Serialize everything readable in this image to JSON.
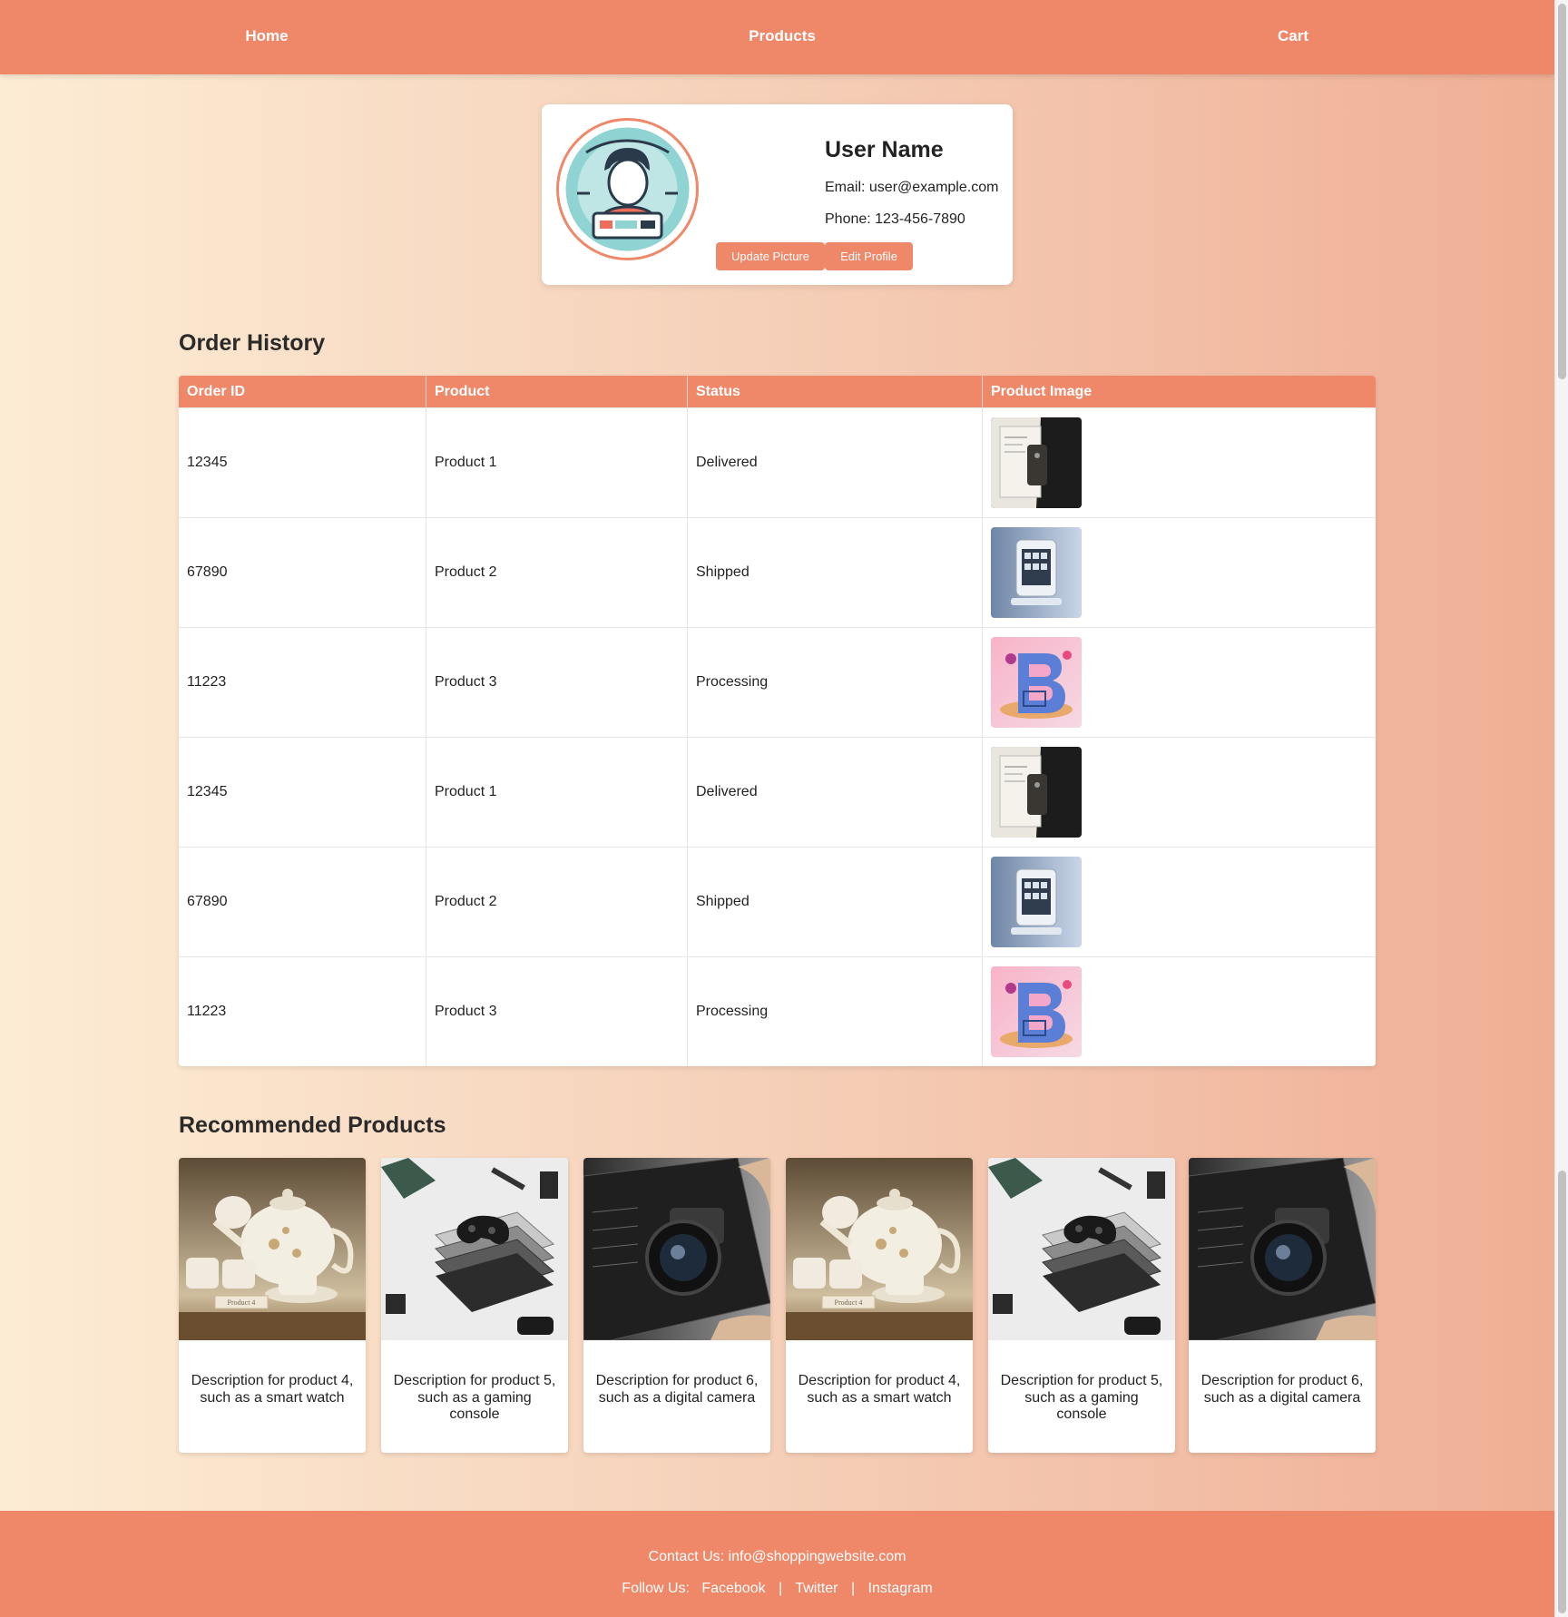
{
  "nav": {
    "home": "Home",
    "products": "Products",
    "cart": "Cart"
  },
  "profile": {
    "name": "User Name",
    "email": "Email: user@example.com",
    "phone": "Phone: 123-456-7890",
    "update_picture": "Update Picture",
    "edit_profile": "Edit Profile"
  },
  "orders": {
    "title": "Order History",
    "headers": [
      "Order ID",
      "Product",
      "Status",
      "Product Image"
    ],
    "rows": [
      {
        "id": "12345",
        "product": "Product 1",
        "status": "Delivered",
        "image": "smart-device-image"
      },
      {
        "id": "67890",
        "product": "Product 2",
        "status": "Shipped",
        "image": "white-gadget-image"
      },
      {
        "id": "11223",
        "product": "Product 3",
        "status": "Processing",
        "image": "colorful-b-logo-image"
      },
      {
        "id": "12345",
        "product": "Product 1",
        "status": "Delivered",
        "image": "smart-device-image"
      },
      {
        "id": "67890",
        "product": "Product 2",
        "status": "Shipped",
        "image": "white-gadget-image"
      },
      {
        "id": "11223",
        "product": "Product 3",
        "status": "Processing",
        "image": "colorful-b-logo-image"
      }
    ]
  },
  "recommended": {
    "title": "Recommended Products",
    "items": [
      {
        "desc": "Description for product 4, such as a smart watch",
        "image": "teapot-image",
        "image_label": "Product 4"
      },
      {
        "desc": "Description for product 5, such as a gaming console",
        "image": "game-console-image"
      },
      {
        "desc": "Description for product 6, such as a digital camera",
        "image": "digital-camera-image"
      },
      {
        "desc": "Description for product 4, such as a smart watch",
        "image": "teapot-image",
        "image_label": "Product 4"
      },
      {
        "desc": "Description for product 5, such as a gaming console",
        "image": "game-console-image"
      },
      {
        "desc": "Description for product 6, such as a digital camera",
        "image": "digital-camera-image"
      }
    ]
  },
  "footer": {
    "contact": "Contact Us: info@shoppingwebsite.com",
    "follow_label": "Follow Us:",
    "facebook": "Facebook",
    "twitter": "Twitter",
    "instagram": "Instagram",
    "separator": "|"
  },
  "colors": {
    "accent": "#ef8769",
    "background_start": "#fdecd4",
    "background_end": "#efae94"
  }
}
